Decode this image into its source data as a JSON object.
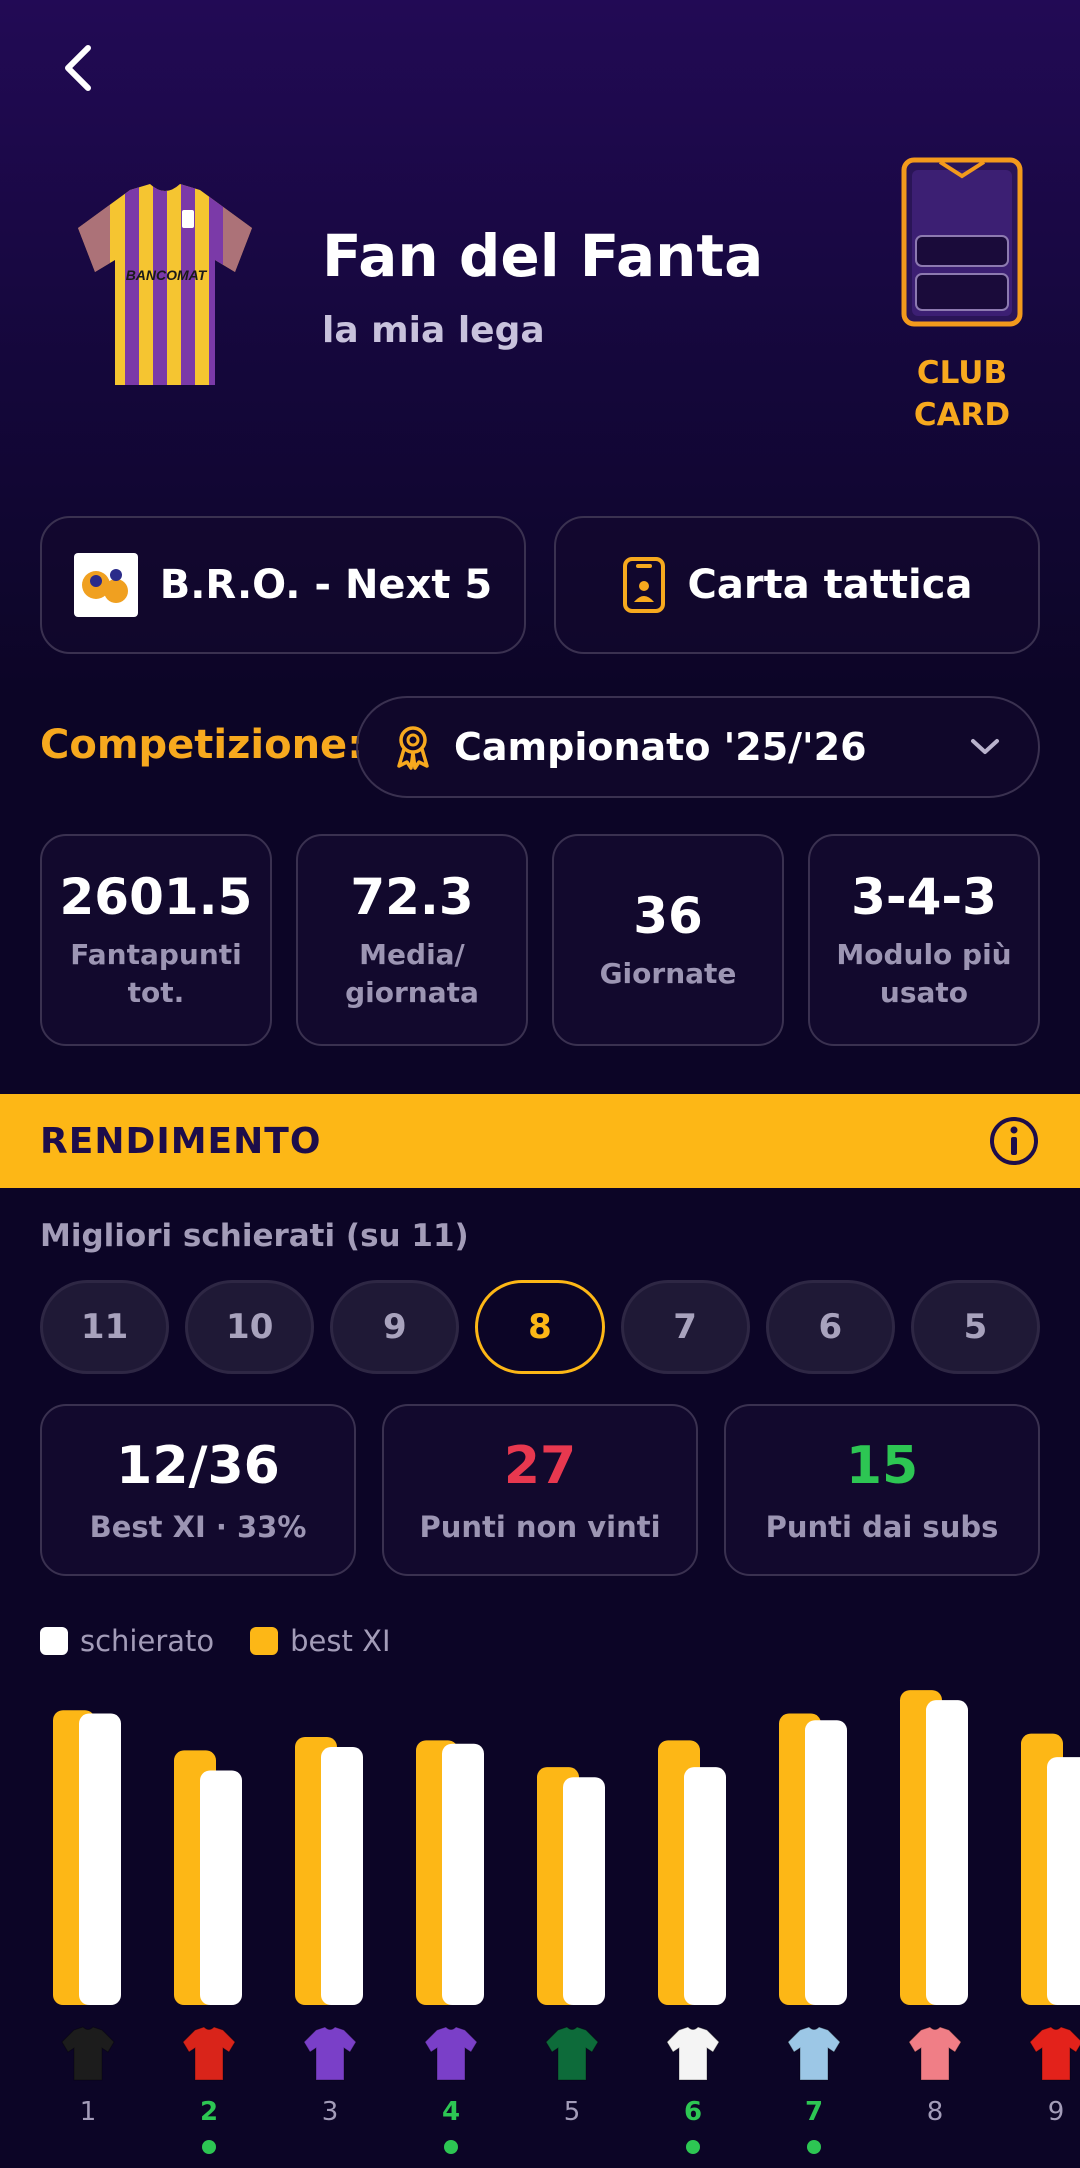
{
  "header": {
    "team_name": "Fan del Fanta",
    "league_name": "la mia lega",
    "club_card_label_1": "CLUB",
    "club_card_label_2": "CARD"
  },
  "buttons": {
    "team": "B.R.O. - Next 5",
    "tactic": "Carta tattica"
  },
  "competition": {
    "label": "Competizione:",
    "selected": "Campionato '25/'26"
  },
  "stats": [
    {
      "value": "2601.5",
      "label_1": "Fantapunti",
      "label_2": "tot."
    },
    {
      "value": "72.3",
      "label_1": "Media/",
      "label_2": "giornata"
    },
    {
      "value": "36",
      "label_1": "Giornate",
      "label_2": ""
    },
    {
      "value": "3-4-3",
      "label_1": "Modulo più",
      "label_2": "usato"
    }
  ],
  "rendimento": {
    "title": "RENDIMENTO",
    "subhead": "Migliori schierati (su 11)",
    "chips": [
      "11",
      "10",
      "9",
      "8",
      "7",
      "6",
      "5"
    ],
    "selected_chip": "8"
  },
  "kpis": [
    {
      "value": "12/36",
      "label": "Best XI · 33%",
      "color": "#ffffff"
    },
    {
      "value": "27",
      "label": "Punti non vinti",
      "color": "#e8384f"
    },
    {
      "value": "15",
      "label": "Punti dai subs",
      "color": "#2dc653"
    }
  ],
  "legend": {
    "schierato": "schierato",
    "best_xi": "best XI"
  },
  "colors": {
    "accent": "#fdb716",
    "bar_white": "#ffffff",
    "green": "#2dc653",
    "red": "#e8384f"
  },
  "chart_data": {
    "type": "bar",
    "categories": [
      "1",
      "2",
      "3",
      "4",
      "5",
      "6",
      "7",
      "8",
      "9"
    ],
    "series": [
      {
        "name": "best XI",
        "values": [
          88,
          76,
          80,
          79,
          71,
          79,
          87,
          94,
          81
        ]
      },
      {
        "name": "schierato",
        "values": [
          87,
          70,
          77,
          78,
          68,
          71,
          85,
          91,
          74
        ]
      }
    ],
    "highlighted": [
      "2",
      "4",
      "6",
      "7"
    ],
    "jersey_colors": [
      "#1c1c1c",
      "#d9241a",
      "#7a3fc8",
      "#7a3fc8",
      "#0d6b3a",
      "#f4f4f4",
      "#9cc7e6",
      "#f07e86",
      "#e3221b"
    ]
  }
}
